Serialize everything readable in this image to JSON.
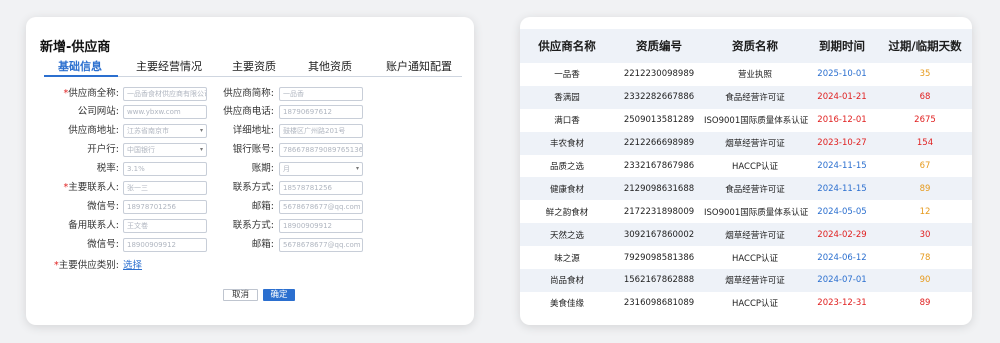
{
  "form": {
    "title": "新增-供应商",
    "tabs": [
      "基础信息",
      "主要经营情况",
      "主要资质",
      "其他资质",
      "账户通知配置"
    ],
    "rows": [
      [
        {
          "label": "供应商全称:",
          "required": true,
          "value": "一品香食材供应商有限公司",
          "select": false
        },
        {
          "label": "供应商简称:",
          "required": false,
          "value": "一品香",
          "select": false
        }
      ],
      [
        {
          "label": "公司网站:",
          "required": false,
          "value": "www.ybxw.com",
          "select": false
        },
        {
          "label": "供应商电话:",
          "required": false,
          "value": "18790697612",
          "select": false
        }
      ],
      [
        {
          "label": "供应商地址:",
          "required": false,
          "value": "江苏省南京市",
          "select": true
        },
        {
          "label": "详细地址:",
          "required": false,
          "value": "鼓楼区广州路201号",
          "select": false
        }
      ],
      [
        {
          "label": "开户行:",
          "required": false,
          "value": "中国银行",
          "select": true
        },
        {
          "label": "银行账号:",
          "required": false,
          "value": "786678879089765136",
          "select": false
        }
      ],
      [
        {
          "label": "税率:",
          "required": false,
          "value": "3.1%",
          "select": false
        },
        {
          "label": "账期:",
          "required": false,
          "value": "月",
          "select": true
        }
      ],
      [
        {
          "label": "主要联系人:",
          "required": true,
          "value": "张一三",
          "select": false
        },
        {
          "label": "联系方式:",
          "required": false,
          "value": "18578781256",
          "select": false
        }
      ],
      [
        {
          "label": "微信号:",
          "required": false,
          "value": "18978701256",
          "select": false
        },
        {
          "label": "邮箱:",
          "required": false,
          "value": "5678678677@qq.com",
          "select": false
        }
      ],
      [
        {
          "label": "备用联系人:",
          "required": false,
          "value": "王文卷",
          "select": false
        },
        {
          "label": "联系方式:",
          "required": false,
          "value": "18900909912",
          "select": false
        }
      ],
      [
        {
          "label": "微信号:",
          "required": false,
          "value": "18900909912",
          "select": false
        },
        {
          "label": "邮箱:",
          "required": false,
          "value": "5678678677@qq.com",
          "select": false
        }
      ]
    ],
    "category_label": "主要供应类别:",
    "category_link": "选择",
    "cancel": "取消",
    "ok": "确定"
  },
  "table": {
    "headers": [
      "供应商名称",
      "资质编号",
      "资质名称",
      "到期时间",
      "过期/临期天数"
    ],
    "rows": [
      {
        "name": "一品香",
        "code": "2212230098989",
        "qual": "营业执照",
        "date": "2025-10-01",
        "date_color": "#2b6fcf",
        "days": "35",
        "days_color": "#e69a1c"
      },
      {
        "name": "香满园",
        "code": "2332282667886",
        "qual": "食品经营许可证",
        "date": "2024-01-21",
        "date_color": "#e02020",
        "days": "68",
        "days_color": "#e02020"
      },
      {
        "name": "满口香",
        "code": "2509013581289",
        "qual": "ISO9001国际质量体系认证",
        "date": "2016-12-01",
        "date_color": "#e02020",
        "days": "2675",
        "days_color": "#e02020"
      },
      {
        "name": "丰农食材",
        "code": "2212266698989",
        "qual": "烟草经营许可证",
        "date": "2023-10-27",
        "date_color": "#e02020",
        "days": "154",
        "days_color": "#e02020"
      },
      {
        "name": "品质之选",
        "code": "2332167867986",
        "qual": "HACCP认证",
        "date": "2024-11-15",
        "date_color": "#2b6fcf",
        "days": "67",
        "days_color": "#e69a1c"
      },
      {
        "name": "健康食材",
        "code": "2129098631688",
        "qual": "食品经营许可证",
        "date": "2024-11-15",
        "date_color": "#2b6fcf",
        "days": "89",
        "days_color": "#e69a1c"
      },
      {
        "name": "鲜之韵食材",
        "code": "2172231898009",
        "qual": "ISO9001国际质量体系认证",
        "date": "2024-05-05",
        "date_color": "#2b6fcf",
        "days": "12",
        "days_color": "#e69a1c"
      },
      {
        "name": "天然之选",
        "code": "3092167860002",
        "qual": "烟草经营许可证",
        "date": "2024-02-29",
        "date_color": "#e02020",
        "days": "30",
        "days_color": "#e02020"
      },
      {
        "name": "味之源",
        "code": "7929098581386",
        "qual": "HACCP认证",
        "date": "2024-06-12",
        "date_color": "#2b6fcf",
        "days": "78",
        "days_color": "#e69a1c"
      },
      {
        "name": "尚品食材",
        "code": "1562167862888",
        "qual": "烟草经营许可证",
        "date": "2024-07-01",
        "date_color": "#2b6fcf",
        "days": "90",
        "days_color": "#e69a1c"
      },
      {
        "name": "美食佳缘",
        "code": "2316098681089",
        "qual": "HACCP认证",
        "date": "2023-12-31",
        "date_color": "#e02020",
        "days": "89",
        "days_color": "#e02020"
      }
    ]
  }
}
